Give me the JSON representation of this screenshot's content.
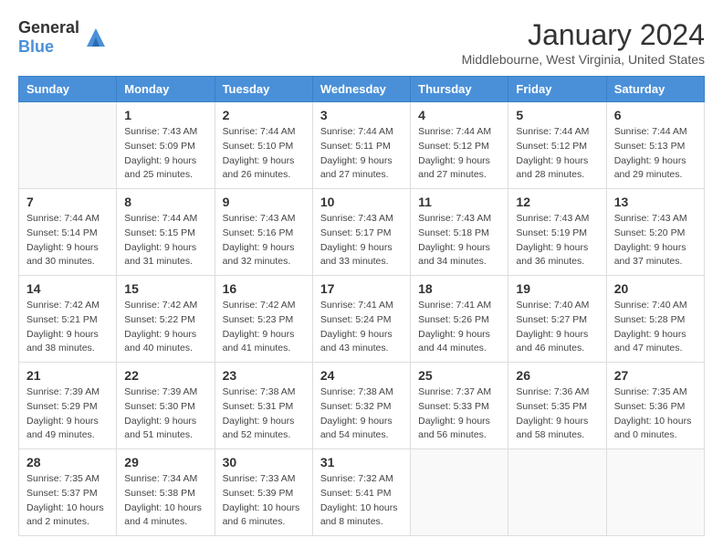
{
  "header": {
    "logo_general": "General",
    "logo_blue": "Blue",
    "month": "January 2024",
    "location": "Middlebourne, West Virginia, United States"
  },
  "days_of_week": [
    "Sunday",
    "Monday",
    "Tuesday",
    "Wednesday",
    "Thursday",
    "Friday",
    "Saturday"
  ],
  "weeks": [
    [
      {
        "day": "",
        "info": ""
      },
      {
        "day": "1",
        "info": "Sunrise: 7:43 AM\nSunset: 5:09 PM\nDaylight: 9 hours\nand 25 minutes."
      },
      {
        "day": "2",
        "info": "Sunrise: 7:44 AM\nSunset: 5:10 PM\nDaylight: 9 hours\nand 26 minutes."
      },
      {
        "day": "3",
        "info": "Sunrise: 7:44 AM\nSunset: 5:11 PM\nDaylight: 9 hours\nand 27 minutes."
      },
      {
        "day": "4",
        "info": "Sunrise: 7:44 AM\nSunset: 5:12 PM\nDaylight: 9 hours\nand 27 minutes."
      },
      {
        "day": "5",
        "info": "Sunrise: 7:44 AM\nSunset: 5:12 PM\nDaylight: 9 hours\nand 28 minutes."
      },
      {
        "day": "6",
        "info": "Sunrise: 7:44 AM\nSunset: 5:13 PM\nDaylight: 9 hours\nand 29 minutes."
      }
    ],
    [
      {
        "day": "7",
        "info": "Sunrise: 7:44 AM\nSunset: 5:14 PM\nDaylight: 9 hours\nand 30 minutes."
      },
      {
        "day": "8",
        "info": "Sunrise: 7:44 AM\nSunset: 5:15 PM\nDaylight: 9 hours\nand 31 minutes."
      },
      {
        "day": "9",
        "info": "Sunrise: 7:43 AM\nSunset: 5:16 PM\nDaylight: 9 hours\nand 32 minutes."
      },
      {
        "day": "10",
        "info": "Sunrise: 7:43 AM\nSunset: 5:17 PM\nDaylight: 9 hours\nand 33 minutes."
      },
      {
        "day": "11",
        "info": "Sunrise: 7:43 AM\nSunset: 5:18 PM\nDaylight: 9 hours\nand 34 minutes."
      },
      {
        "day": "12",
        "info": "Sunrise: 7:43 AM\nSunset: 5:19 PM\nDaylight: 9 hours\nand 36 minutes."
      },
      {
        "day": "13",
        "info": "Sunrise: 7:43 AM\nSunset: 5:20 PM\nDaylight: 9 hours\nand 37 minutes."
      }
    ],
    [
      {
        "day": "14",
        "info": "Sunrise: 7:42 AM\nSunset: 5:21 PM\nDaylight: 9 hours\nand 38 minutes."
      },
      {
        "day": "15",
        "info": "Sunrise: 7:42 AM\nSunset: 5:22 PM\nDaylight: 9 hours\nand 40 minutes."
      },
      {
        "day": "16",
        "info": "Sunrise: 7:42 AM\nSunset: 5:23 PM\nDaylight: 9 hours\nand 41 minutes."
      },
      {
        "day": "17",
        "info": "Sunrise: 7:41 AM\nSunset: 5:24 PM\nDaylight: 9 hours\nand 43 minutes."
      },
      {
        "day": "18",
        "info": "Sunrise: 7:41 AM\nSunset: 5:26 PM\nDaylight: 9 hours\nand 44 minutes."
      },
      {
        "day": "19",
        "info": "Sunrise: 7:40 AM\nSunset: 5:27 PM\nDaylight: 9 hours\nand 46 minutes."
      },
      {
        "day": "20",
        "info": "Sunrise: 7:40 AM\nSunset: 5:28 PM\nDaylight: 9 hours\nand 47 minutes."
      }
    ],
    [
      {
        "day": "21",
        "info": "Sunrise: 7:39 AM\nSunset: 5:29 PM\nDaylight: 9 hours\nand 49 minutes."
      },
      {
        "day": "22",
        "info": "Sunrise: 7:39 AM\nSunset: 5:30 PM\nDaylight: 9 hours\nand 51 minutes."
      },
      {
        "day": "23",
        "info": "Sunrise: 7:38 AM\nSunset: 5:31 PM\nDaylight: 9 hours\nand 52 minutes."
      },
      {
        "day": "24",
        "info": "Sunrise: 7:38 AM\nSunset: 5:32 PM\nDaylight: 9 hours\nand 54 minutes."
      },
      {
        "day": "25",
        "info": "Sunrise: 7:37 AM\nSunset: 5:33 PM\nDaylight: 9 hours\nand 56 minutes."
      },
      {
        "day": "26",
        "info": "Sunrise: 7:36 AM\nSunset: 5:35 PM\nDaylight: 9 hours\nand 58 minutes."
      },
      {
        "day": "27",
        "info": "Sunrise: 7:35 AM\nSunset: 5:36 PM\nDaylight: 10 hours\nand 0 minutes."
      }
    ],
    [
      {
        "day": "28",
        "info": "Sunrise: 7:35 AM\nSunset: 5:37 PM\nDaylight: 10 hours\nand 2 minutes."
      },
      {
        "day": "29",
        "info": "Sunrise: 7:34 AM\nSunset: 5:38 PM\nDaylight: 10 hours\nand 4 minutes."
      },
      {
        "day": "30",
        "info": "Sunrise: 7:33 AM\nSunset: 5:39 PM\nDaylight: 10 hours\nand 6 minutes."
      },
      {
        "day": "31",
        "info": "Sunrise: 7:32 AM\nSunset: 5:41 PM\nDaylight: 10 hours\nand 8 minutes."
      },
      {
        "day": "",
        "info": ""
      },
      {
        "day": "",
        "info": ""
      },
      {
        "day": "",
        "info": ""
      }
    ]
  ]
}
